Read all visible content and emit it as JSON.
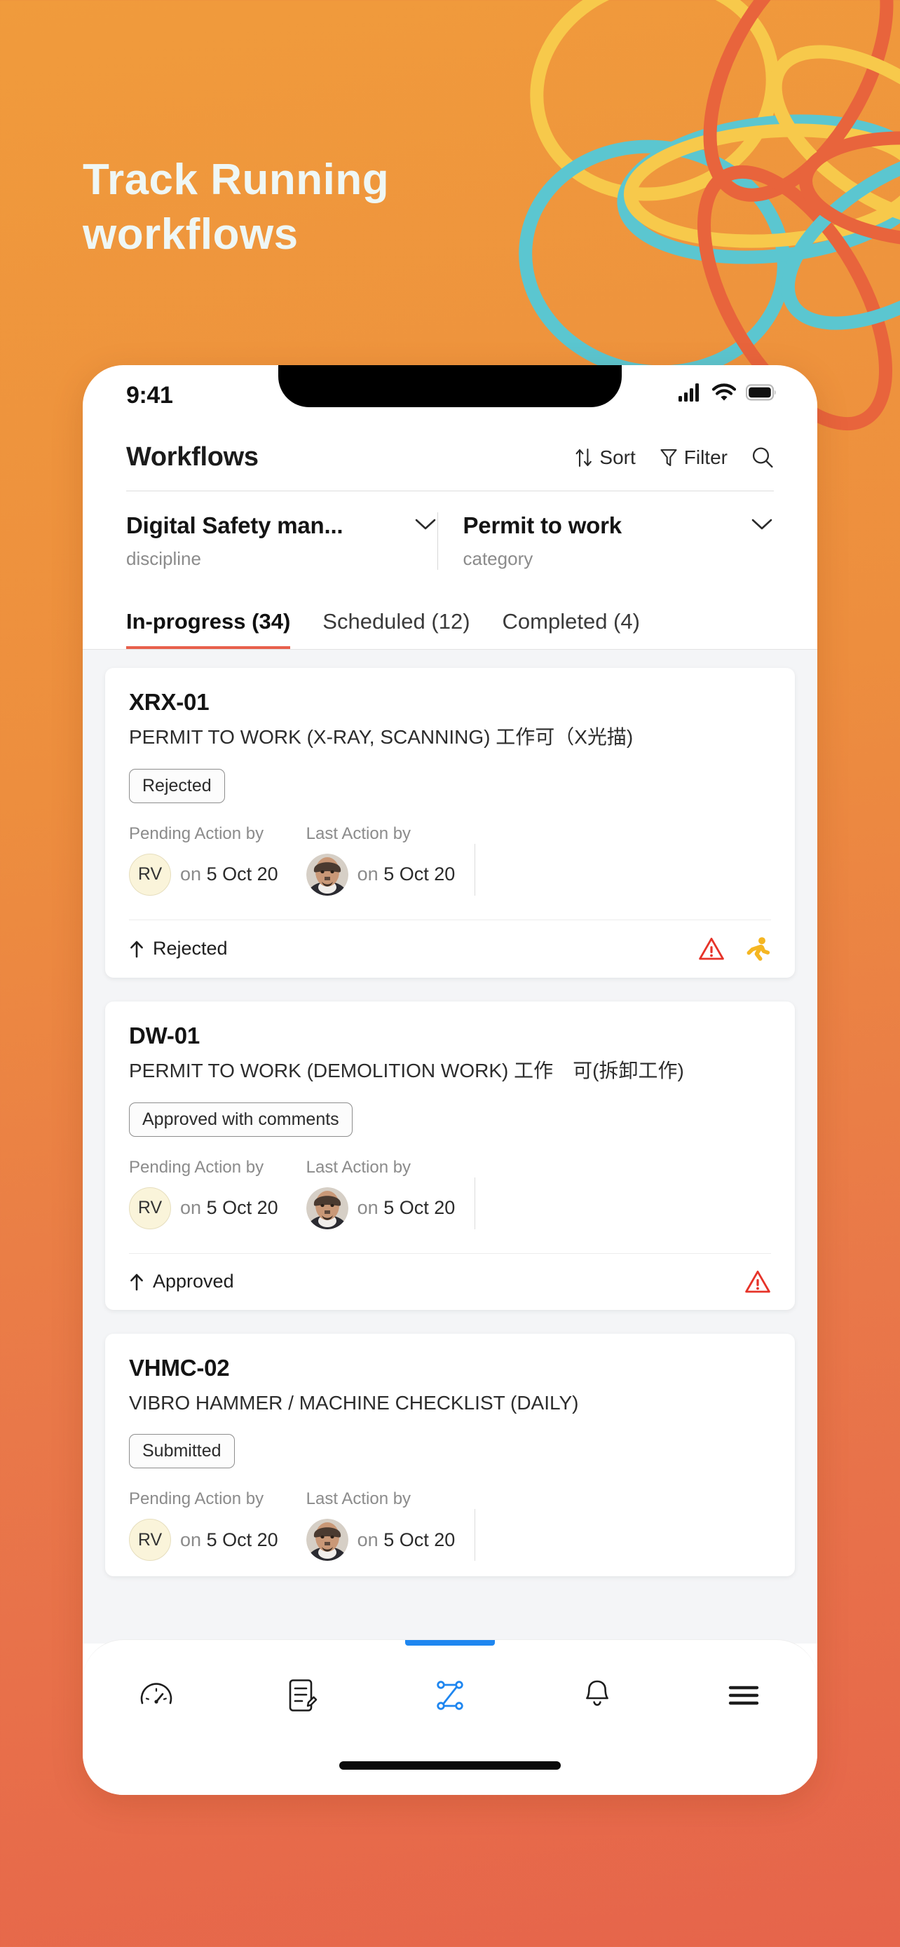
{
  "promo": {
    "line1": "Track Running",
    "line2": "workflows",
    "text_color": "#EFF7F5",
    "bg_top_color": "#F09B3C",
    "bg_bottom_color": "#E6644B"
  },
  "decoration": {
    "name": "flower-loops",
    "colors": {
      "yellow": "#F7C94B",
      "teal": "#5BC6D0",
      "orange": "#E8643C"
    }
  },
  "status_bar": {
    "time": "9:41",
    "icons": [
      "cellular-signal-icon",
      "wifi-icon",
      "battery-icon"
    ]
  },
  "header": {
    "title": "Workflows",
    "sort_label": "Sort",
    "filter_label": "Filter",
    "sort_icon": "sort-arrows-icon",
    "filter_icon": "funnel-icon",
    "search_icon": "search-icon"
  },
  "filters": [
    {
      "value": "Digital Safety man...",
      "label": "discipline",
      "icon": "chevron-down-icon"
    },
    {
      "value": "Permit to work",
      "label": "category",
      "icon": "chevron-down-icon"
    }
  ],
  "tabs": [
    {
      "label": "In-progress (34)",
      "active": true
    },
    {
      "label": "Scheduled (12)",
      "active": false
    },
    {
      "label": "Completed (4)",
      "active": false
    }
  ],
  "tab_accent_color": "#E8604C",
  "labels": {
    "pending_action_by": "Pending Action by",
    "last_action_by": "Last Action by",
    "on": "on"
  },
  "cards": [
    {
      "code": "XRX-01",
      "description": "PERMIT TO WORK (X-RAY, SCANNING) 工作可（X光描)",
      "status_chip": "Rejected",
      "pending_initials": "RV",
      "pending_date": "5 Oct 20",
      "last_avatar": "user-photo-avatar",
      "last_date": "5 Oct 20",
      "footer_label": "Rejected",
      "footer_icon": "arrow-up-icon",
      "icons": [
        "warning-triangle-icon",
        "running-person-icon"
      ]
    },
    {
      "code": "DW-01",
      "description": "PERMIT TO WORK (DEMOLITION WORK) 工作　可(拆卸工作)",
      "status_chip": "Approved with comments",
      "pending_initials": "RV",
      "pending_date": "5 Oct 20",
      "last_avatar": "user-photo-avatar",
      "last_date": "5 Oct 20",
      "footer_label": "Approved",
      "footer_icon": "arrow-up-icon",
      "icons": [
        "warning-triangle-icon"
      ]
    },
    {
      "code": "VHMC-02",
      "description": "VIBRO HAMMER / MACHINE CHECKLIST (DAILY)",
      "status_chip": "Submitted",
      "pending_initials": "RV",
      "pending_date": "5 Oct 20",
      "last_avatar": "user-photo-avatar",
      "last_date": "5 Oct 20",
      "footer_label": "",
      "footer_icon": "",
      "icons": []
    }
  ],
  "status_colors": {
    "warning": "#E63329",
    "running": "#F5B622"
  },
  "bottom_nav": {
    "active_color": "#1E86F0",
    "items": [
      {
        "icon": "dashboard-gauge-icon",
        "active": false
      },
      {
        "icon": "form-document-icon",
        "active": false
      },
      {
        "icon": "workflow-nodes-icon",
        "active": true
      },
      {
        "icon": "bell-notification-icon",
        "active": false
      },
      {
        "icon": "hamburger-menu-icon",
        "active": false
      }
    ]
  }
}
